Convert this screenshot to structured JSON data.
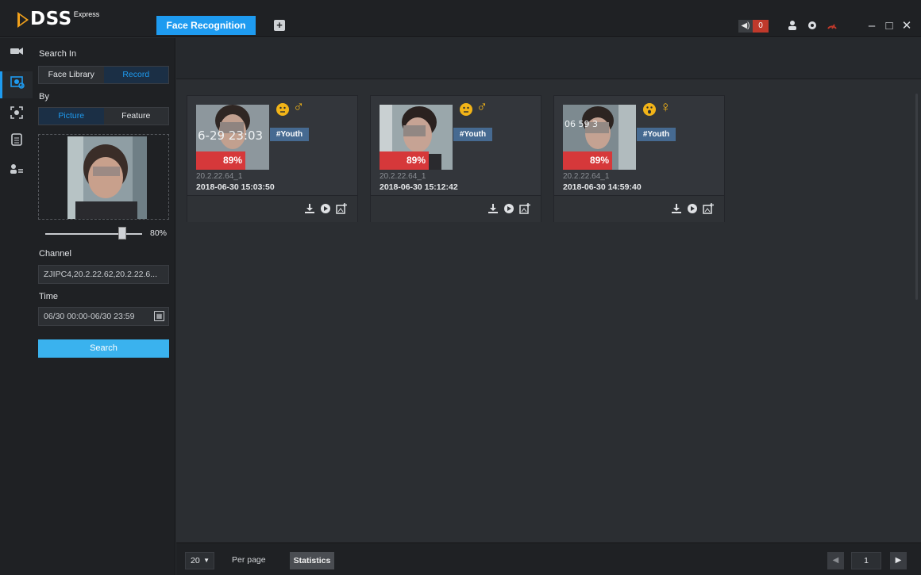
{
  "app": {
    "name": "DSS",
    "edition": "Express"
  },
  "tabs": [
    {
      "label": "Face Recognition",
      "active": true
    }
  ],
  "titlebar": {
    "add_tab_icon": "plus-square-icon",
    "alarm_count": "0",
    "icons": [
      "speaker-icon",
      "user-icon",
      "gear-icon",
      "gauge-icon"
    ],
    "window_controls": {
      "minimize": "–",
      "maximize": "□",
      "close": "✕"
    }
  },
  "rail": [
    {
      "icon": "camera-icon",
      "active": false
    },
    {
      "icon": "face-search-icon",
      "active": true
    },
    {
      "icon": "face-scan-icon",
      "active": false
    },
    {
      "icon": "document-icon",
      "active": false
    },
    {
      "icon": "user-list-icon",
      "active": false
    }
  ],
  "search": {
    "search_in_label": "Search In",
    "search_in_options": [
      "Face Library",
      "Record"
    ],
    "search_in_selected": "Record",
    "by_label": "By",
    "by_options": [
      "Picture",
      "Feature"
    ],
    "by_selected": "Picture",
    "similarity": "80%",
    "similarity_value": 0.8,
    "channel_label": "Channel",
    "channel_value": "ZJIPC4,20.2.22.62,20.2.22.6...",
    "time_label": "Time",
    "time_value": "06/30 00:00-06/30 23:59",
    "search_button": "Search"
  },
  "results": [
    {
      "thumb_text": "6-29 23:03",
      "score": "89%",
      "expression": "neutral",
      "gender_symbol": "♂",
      "tag": "#Youth",
      "channel": "20.2.22.64_1",
      "time": "2018-06-30 15:03:50"
    },
    {
      "thumb_text": "",
      "score": "89%",
      "expression": "neutral",
      "gender_symbol": "♂",
      "tag": "#Youth",
      "channel": "20.2.22.64_1",
      "time": "2018-06-30 15:12:42"
    },
    {
      "thumb_text": "06  59 3",
      "score": "89%",
      "expression": "surprised",
      "gender_symbol": "♀",
      "tag": "#Youth",
      "channel": "20.2.22.64_1",
      "time": "2018-06-30 14:59:40"
    }
  ],
  "card_actions": [
    "download-icon",
    "playback-icon",
    "add-to-library-icon"
  ],
  "pagination": {
    "page_size": "20",
    "per_page_label": "Per page",
    "statistics_button": "Statistics",
    "current_page": "1"
  },
  "colors": {
    "accent": "#1e9bf0",
    "score": "#d6383a",
    "tag": "#466a91",
    "emoji": "#f2b418"
  }
}
